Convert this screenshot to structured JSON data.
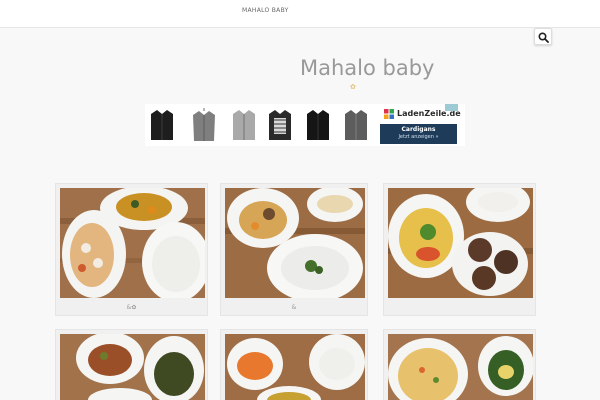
{
  "nav": {
    "label": "MAHALO BABY"
  },
  "search": {
    "icon": "search-icon"
  },
  "site": {
    "title": "Mahalo baby",
    "mark": "✿"
  },
  "ad": {
    "brand": "LadenZeile.de",
    "product_label": "Cardigans",
    "cta": "Jetzt anzeigen »",
    "badge_color": "#9ccbd6",
    "cta_color": "#1e3c5a",
    "products": [
      "black cardigan",
      "grey cardigan on hanger",
      "grey zip cardigan",
      "patterned cardigan",
      "black cardigan",
      "grey cardigan"
    ]
  },
  "posts": [
    {
      "caption": "&✿",
      "image": "baby food: vegetable stew, pumpkin, rice porridge"
    },
    {
      "caption": "&",
      "image": "baby food: meat stew, soup, porridge with greens"
    },
    {
      "caption": "",
      "image": "baby food: vegetable soup, rice porridge, meatballs"
    },
    {
      "caption": "",
      "image": "baby food: vegetables, greens, porridge"
    },
    {
      "caption": "",
      "image": "baby food: carrot soup, porridge"
    },
    {
      "caption": "",
      "image": "baby food: omelette, spinach soup"
    }
  ]
}
